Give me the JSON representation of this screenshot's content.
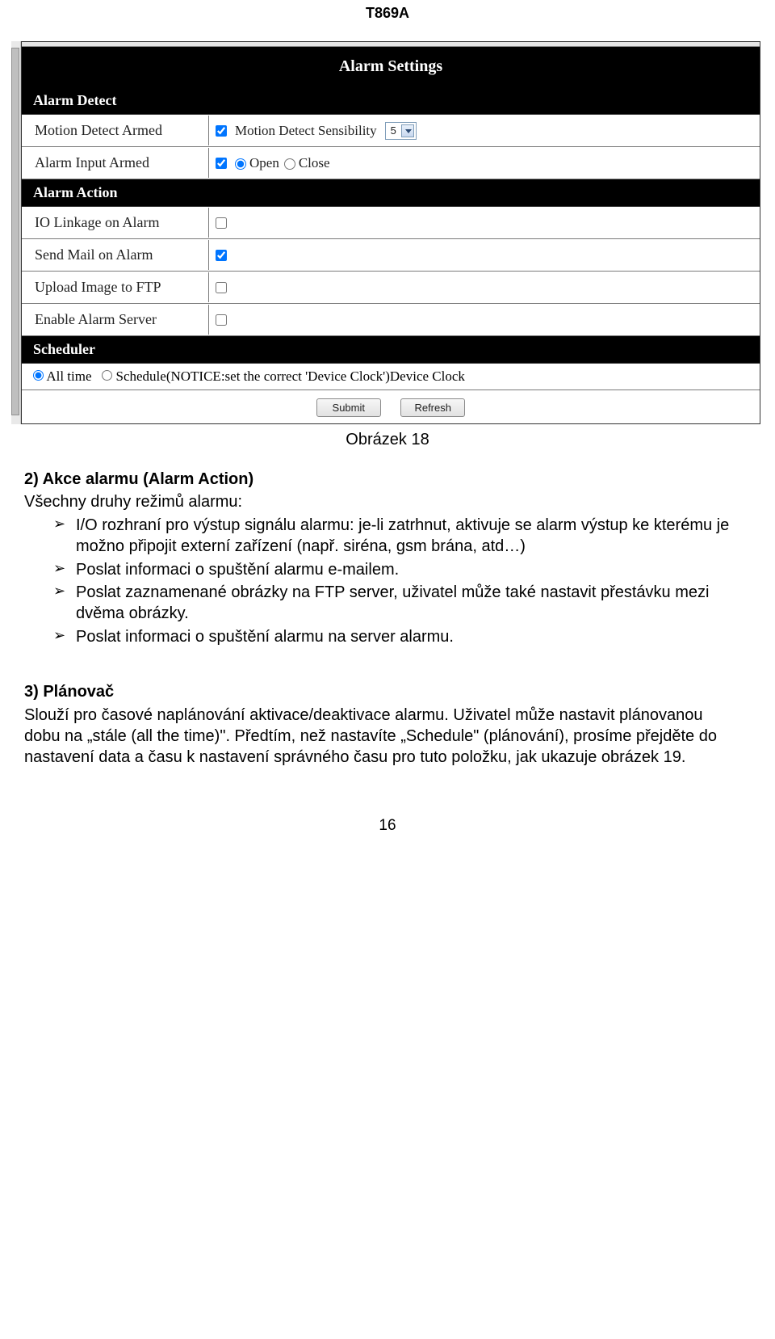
{
  "doc_code": "T869A",
  "alarm_settings": {
    "title": "Alarm Settings",
    "sections": {
      "detect": "Alarm Detect",
      "action": "Alarm Action",
      "scheduler": "Scheduler"
    },
    "rows": {
      "motion_armed_label": "Motion Detect Armed",
      "motion_sens_label": "Motion Detect Sensibility",
      "motion_sens_value": "5",
      "input_armed_label": "Alarm Input Armed",
      "open_label": "Open",
      "close_label": "Close",
      "io_linkage_label": "IO Linkage on Alarm",
      "send_mail_label": "Send Mail on Alarm",
      "upload_ftp_label": "Upload Image to FTP",
      "enable_server_label": "Enable Alarm Server",
      "scheduler_alltime": "All time",
      "scheduler_schedule": "Schedule(NOTICE:set the correct 'Device Clock')Device Clock"
    },
    "buttons": {
      "submit": "Submit",
      "refresh": "Refresh"
    }
  },
  "caption": "Obrázek 18",
  "section2": {
    "title": "2) Akce alarmu (Alarm Action)",
    "intro": "Všechny druhy režimů alarmu:",
    "bullets": [
      "I/O rozhraní pro výstup signálu alarmu: je-li zatrhnut, aktivuje se alarm výstup ke kterému je možno připojit externí zařízení (např. siréna, gsm brána, atd…)",
      "Poslat informaci o spuštění alarmu e-mailem.",
      "Poslat zaznamenané obrázky na FTP server, uživatel může také nastavit přestávku mezi dvěma obrázky.",
      "Poslat informaci o spuštění alarmu na server alarmu."
    ]
  },
  "section3": {
    "title": "3) Plánovač",
    "body": "Slouží pro časové naplánování aktivace/deaktivace alarmu. Uživatel může nastavit plánovanou dobu na „stále (all the time)\". Předtím, než nastavíte „Schedule\" (plánování), prosíme přejděte do nastavení data a času k nastavení správného času pro tuto položku, jak ukazuje obrázek 19."
  },
  "page_number": "16"
}
